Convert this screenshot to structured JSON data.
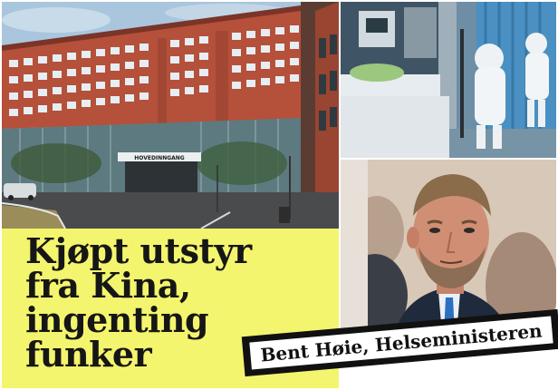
{
  "headline": {
    "line1": "Kjøpt utstyr",
    "line2": "fra Kina,",
    "line3": "ingenting",
    "line4": "funker"
  },
  "caption": {
    "name": "Bent Høie, Helseministeren"
  },
  "hospital_photo": {
    "entrance_sign": "HOVEDINNGANG"
  },
  "colors": {
    "headline_background": "#f4f56e",
    "banner_background": "#111111",
    "brick": "#b5503b"
  }
}
